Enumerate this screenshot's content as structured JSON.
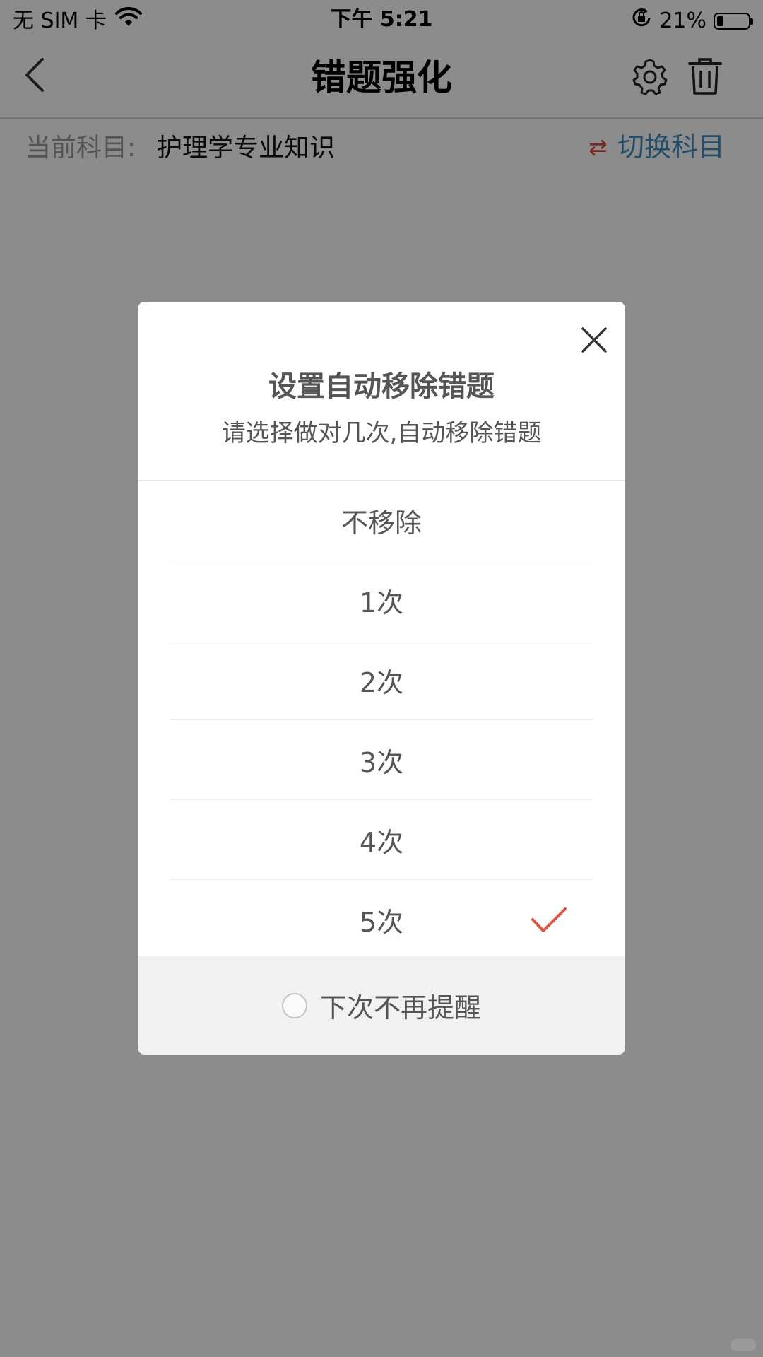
{
  "status_bar": {
    "carrier": "无 SIM 卡",
    "time": "下午 5:21",
    "battery_percent": "21%",
    "battery_level": 0.21,
    "icons": [
      "wifi-icon",
      "rotation-lock-icon",
      "battery-icon"
    ]
  },
  "nav": {
    "title": "错题强化",
    "icons": [
      "back-chevron-icon",
      "gear-icon",
      "trash-icon"
    ]
  },
  "subject": {
    "label": "当前科目:",
    "value": "护理学专业知识",
    "switch_label": "切换科目",
    "switch_icon": "⇄"
  },
  "dialog": {
    "title": "设置自动移除错题",
    "subtitle": "请选择做对几次,自动移除错题",
    "options": [
      {
        "label": "不移除",
        "selected": false
      },
      {
        "label": "1次",
        "selected": false
      },
      {
        "label": "2次",
        "selected": false
      },
      {
        "label": "3次",
        "selected": false
      },
      {
        "label": "4次",
        "selected": false
      },
      {
        "label": "5次",
        "selected": true
      }
    ],
    "footer_label": "下次不再提醒",
    "footer_checked": false,
    "accent_color": "#e0533f",
    "icons": [
      "close-icon",
      "checkmark-icon",
      "radio-icon"
    ]
  },
  "colors": {
    "switch_icon": "#d94a3a",
    "switch_label": "#3f8fc4",
    "overlay": "rgba(0,0,0,0.45)"
  }
}
